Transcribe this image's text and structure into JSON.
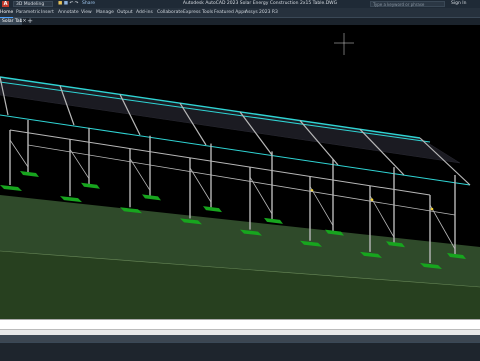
{
  "titlebar": {
    "logo": "A",
    "workspace": "3D Modeling",
    "share": "Share",
    "app_title": "Autodesk AutoCAD 2023   Solar Energy Construction 2x15 Table.DWG",
    "search_placeholder": "Type a keyword or phrase",
    "sign_in": "Sign In"
  },
  "ribbon": {
    "tabs": [
      "Home",
      "Parametric",
      "Insert",
      "Annotate",
      "View",
      "Manage",
      "Output",
      "Add-ins",
      "Collaborate",
      "Express Tools",
      "Featured Apps",
      "Assys",
      "2023 R3"
    ],
    "active": "Home"
  },
  "document": {
    "tab_label": "Solar Table*",
    "close_glyph": "×",
    "add_glyph": "+"
  },
  "colors": {
    "background": "#000000",
    "ground": "#2f4a2a",
    "frame": "#b8b8b8",
    "rail": "#2fd4d4",
    "panel": "#1b1b22",
    "footing": "#17a51e"
  }
}
